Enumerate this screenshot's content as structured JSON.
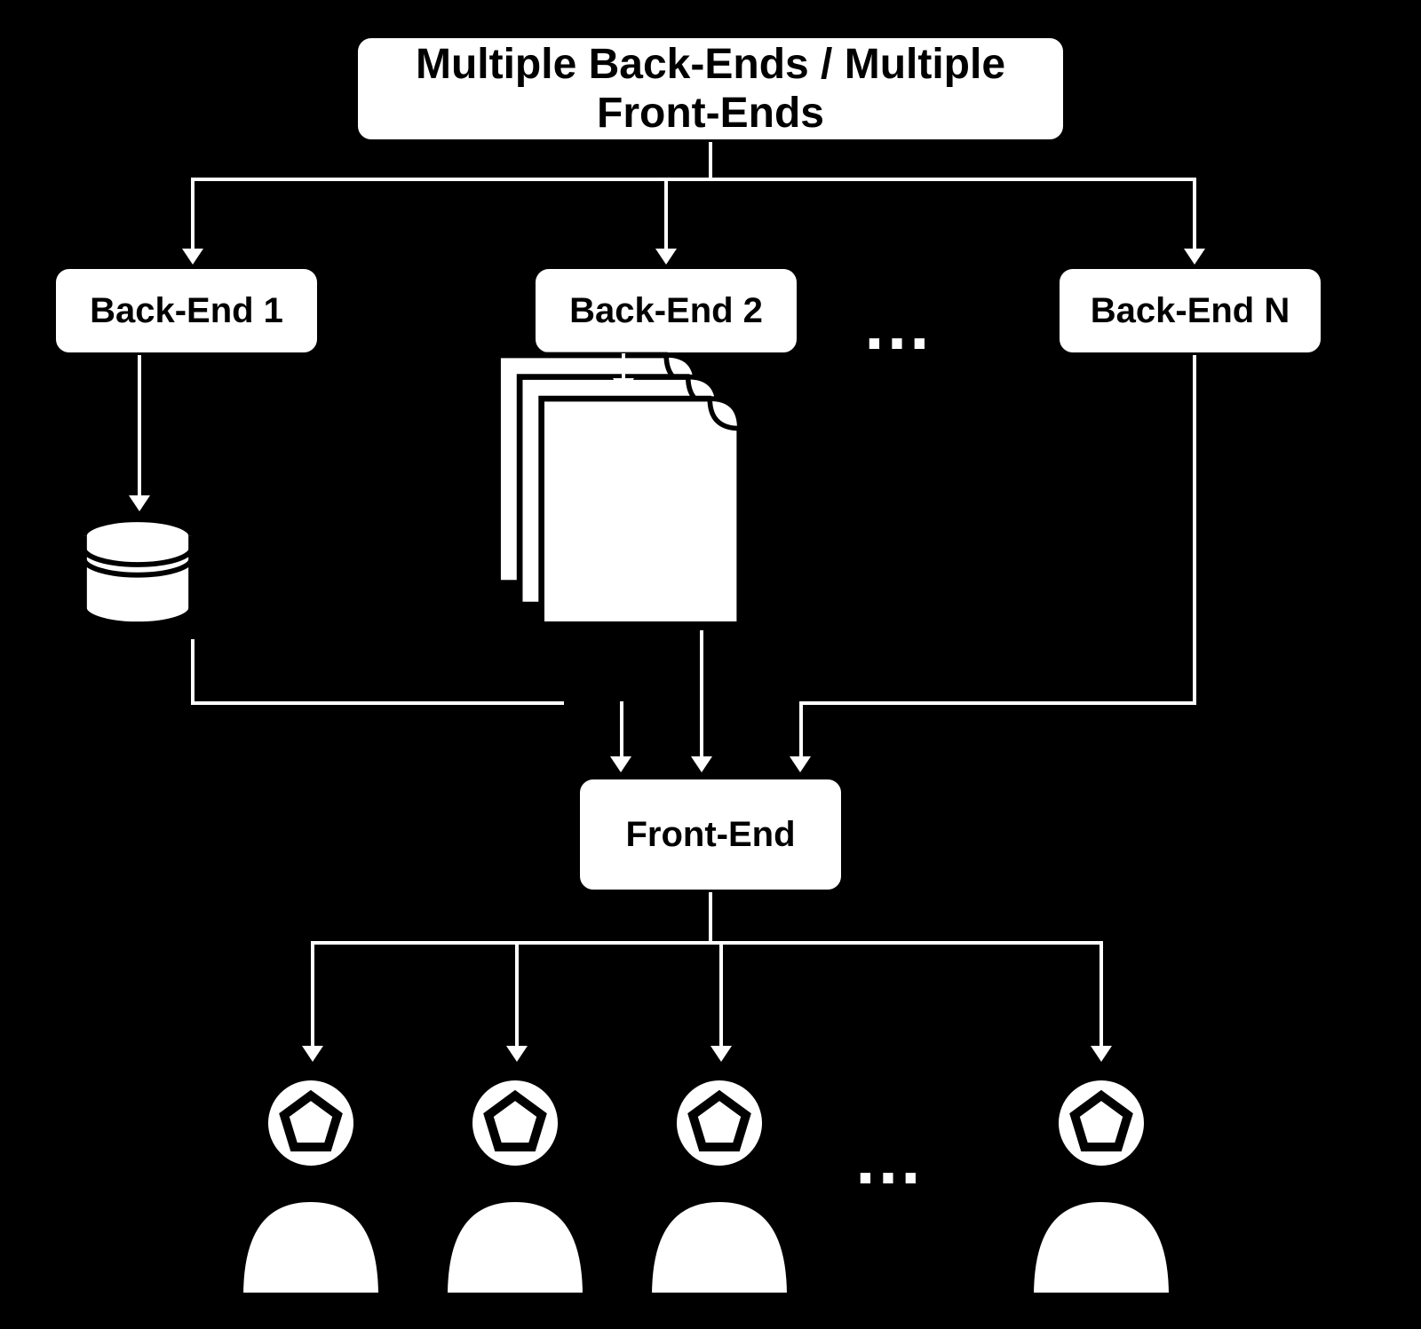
{
  "title": "Multiple Back-Ends / Multiple\nFront-Ends",
  "nodes": {
    "backend1": "Back-End 1",
    "backend2": "Back-End 2",
    "backendN": "Back-End N",
    "frontend": "Front-End"
  },
  "ellipsis": "…",
  "icons": {
    "database": "database-icon",
    "pages": "pages-icon",
    "user": "user-icon"
  }
}
